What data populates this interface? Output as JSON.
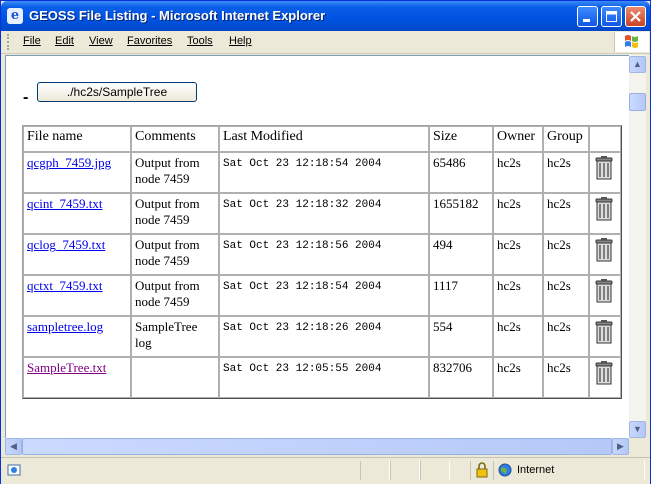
{
  "window": {
    "title": "GEOSS File Listing - Microsoft Internet Explorer",
    "menu": [
      "File",
      "Edit",
      "View",
      "Favorites",
      "Tools",
      "Help"
    ]
  },
  "page": {
    "dash": "-",
    "path_button": "./hc2s/SampleTree",
    "columns": [
      "File name",
      "Comments",
      "Last Modified",
      "Size",
      "Owner",
      "Group"
    ],
    "rows": [
      {
        "file": "qcgph_7459.jpg",
        "comment": "Output from node 7459",
        "modified": "Sat Oct 23 12:18:54 2004",
        "size": "65486",
        "owner": "hc2s",
        "group": "hc2s"
      },
      {
        "file": "qcint_7459.txt",
        "comment": "Output from node 7459",
        "modified": "Sat Oct 23 12:18:32 2004",
        "size": "1655182",
        "owner": "hc2s",
        "group": "hc2s"
      },
      {
        "file": "qclog_7459.txt",
        "comment": "Output from node 7459",
        "modified": "Sat Oct 23 12:18:56 2004",
        "size": "494",
        "owner": "hc2s",
        "group": "hc2s"
      },
      {
        "file": "qctxt_7459.txt",
        "comment": "Output from node 7459",
        "modified": "Sat Oct 23 12:18:54 2004",
        "size": "1117",
        "owner": "hc2s",
        "group": "hc2s"
      },
      {
        "file": "sampletree.log",
        "comment": "SampleTree log",
        "modified": "Sat Oct 23 12:18:26 2004",
        "size": "554",
        "owner": "hc2s",
        "group": "hc2s"
      },
      {
        "file": "SampleTree.txt",
        "comment": "",
        "modified": "Sat Oct 23 12:05:55 2004",
        "size": "832706",
        "owner": "hc2s",
        "group": "hc2s"
      }
    ]
  },
  "status": {
    "zone": "Internet",
    "lock_icon": "padlock-icon",
    "zone_icon": "globe-icon"
  }
}
